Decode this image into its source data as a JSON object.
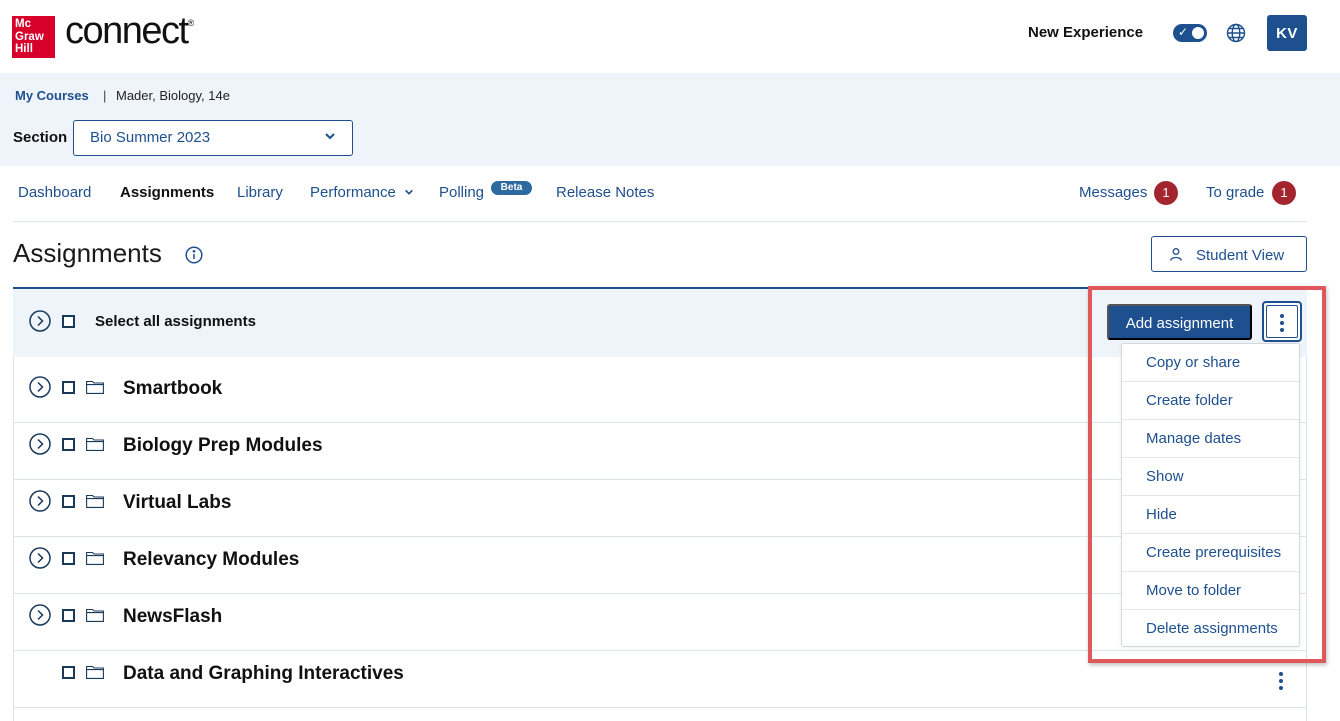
{
  "header": {
    "logo_text": [
      "Mc",
      "Graw",
      "Hill"
    ],
    "logo_word": "connect",
    "logo_mark": "®",
    "new_experience_label": "New Experience",
    "avatar_initials": "KV"
  },
  "breadcrumb": {
    "link": "My Courses",
    "separator": "|",
    "current": "Mader, Biology, 14e"
  },
  "section": {
    "label": "Section",
    "selected": "Bio Summer 2023"
  },
  "nav": {
    "dashboard": "Dashboard",
    "assignments": "Assignments",
    "library": "Library",
    "performance": "Performance",
    "polling": "Polling",
    "beta": "Beta",
    "release_notes": "Release Notes",
    "messages": "Messages",
    "messages_count": "1",
    "to_grade": "To grade",
    "to_grade_count": "1"
  },
  "page": {
    "title": "Assignments",
    "student_view": "Student View"
  },
  "toolbar": {
    "select_all": "Select all assignments",
    "add_assignment": "Add assignment"
  },
  "folders": [
    {
      "title": "Smartbook"
    },
    {
      "title": "Biology Prep Modules"
    },
    {
      "title": "Virtual Labs"
    },
    {
      "title": "Relevancy Modules"
    },
    {
      "title": "NewsFlash"
    },
    {
      "title": "Data and Graphing Interactives"
    }
  ],
  "menu": {
    "items": [
      "Copy or share",
      "Create folder",
      "Manage dates",
      "Show",
      "Hide",
      "Create prerequisites",
      "Move to folder",
      "Delete assignments"
    ]
  },
  "colors": {
    "brand_red": "#d6002a",
    "primary_blue": "#1e4f8e",
    "badge_red": "#a3262f",
    "band_bg": "#eef4fa",
    "highlight": "#e0595a"
  }
}
